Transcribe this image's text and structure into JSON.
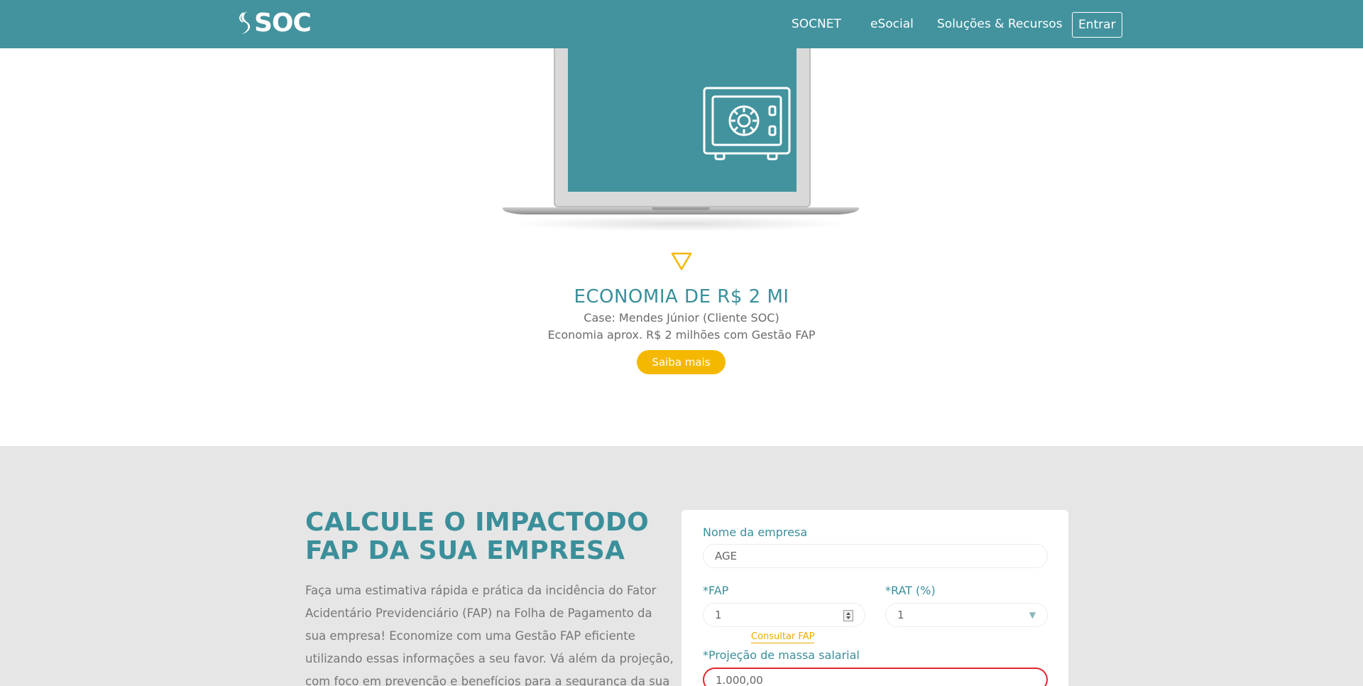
{
  "header": {
    "logo_text": "SOC",
    "nav": {
      "socnet": "SOCNET",
      "esocial": "eSocial",
      "solucoes": "Soluções & Recursos",
      "entrar": "Entrar"
    }
  },
  "case": {
    "title": "ECONOMIA DE R$ 2 MI",
    "line1": "Case: Mendes Júnior (Cliente SOC)",
    "line2": "Economia aprox. R$ 2 milhões com Gestão FAP",
    "button": "Saiba mais"
  },
  "calculator": {
    "title": "CALCULE O IMPACTODO FAP DA SUA EMPRESA",
    "description": "Faça uma estimativa rápida e prática da incidência do Fator Acidentário Previdenciário (FAP) na Folha de Pagamento da sua empresa! Economize com uma Gestão FAP eficiente utilizando essas informações a seu favor. Vá além da projeção, com foco em prevenção e benefícios para a segurança da sua equipe e para a",
    "form": {
      "nome_label": "Nome da empresa",
      "nome_value": "AGE",
      "fap_label": "*FAP",
      "fap_value": "1",
      "rat_label": "*RAT (%)",
      "rat_value": "1",
      "consultar_link": "Consultar FAP",
      "proj_label": "*Projeção de massa salarial",
      "proj_value": "1.000,00"
    }
  },
  "colors": {
    "brand_teal": "#42939e",
    "accent_yellow": "#f5b800",
    "error_red": "#e0262d",
    "section_grey": "#e6e6e6"
  },
  "icons": [
    "logo-swirl-icon",
    "safe-icon",
    "triangle-down-icon",
    "spinner-icon",
    "dropdown-arrow-icon"
  ]
}
